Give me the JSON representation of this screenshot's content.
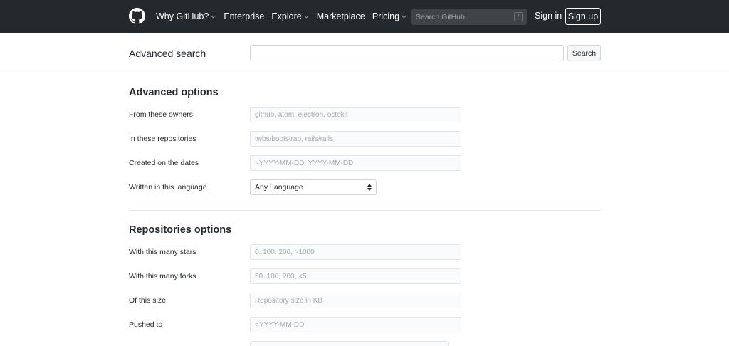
{
  "header": {
    "nav": [
      {
        "label": "Why GitHub?",
        "has_caret": true
      },
      {
        "label": "Enterprise",
        "has_caret": false
      },
      {
        "label": "Explore",
        "has_caret": true
      },
      {
        "label": "Marketplace",
        "has_caret": false
      },
      {
        "label": "Pricing",
        "has_caret": true
      }
    ],
    "search_placeholder": "Search GitHub",
    "search_key": "/",
    "signin_label": "Sign in",
    "signup_label": "Sign up"
  },
  "search_bar": {
    "title": "Advanced search",
    "query_value": "",
    "button_label": "Search"
  },
  "advanced_options": {
    "title": "Advanced options",
    "fields": [
      {
        "label": "From these owners",
        "placeholder": "github, atom, electron, octokit"
      },
      {
        "label": "In these repositories",
        "placeholder": "twbs/bootstrap, rails/rails"
      },
      {
        "label": "Created on the dates",
        "placeholder": ">YYYY-MM-DD, YYYY-MM-DD"
      }
    ],
    "language": {
      "label": "Written in this language",
      "selected": "Any Language"
    }
  },
  "repositories_options": {
    "title": "Repositories options",
    "fields": [
      {
        "label": "With this many stars",
        "placeholder": "0..100, 200, >1000"
      },
      {
        "label": "With this many forks",
        "placeholder": "50..100, 200, <5"
      },
      {
        "label": "Of this size",
        "placeholder": "Repository size in KB"
      },
      {
        "label": "Pushed to",
        "placeholder": "<YYYY-MM-DD"
      }
    ]
  },
  "colors": {
    "header_bg": "#24292e",
    "border": "#e1e4e8"
  }
}
